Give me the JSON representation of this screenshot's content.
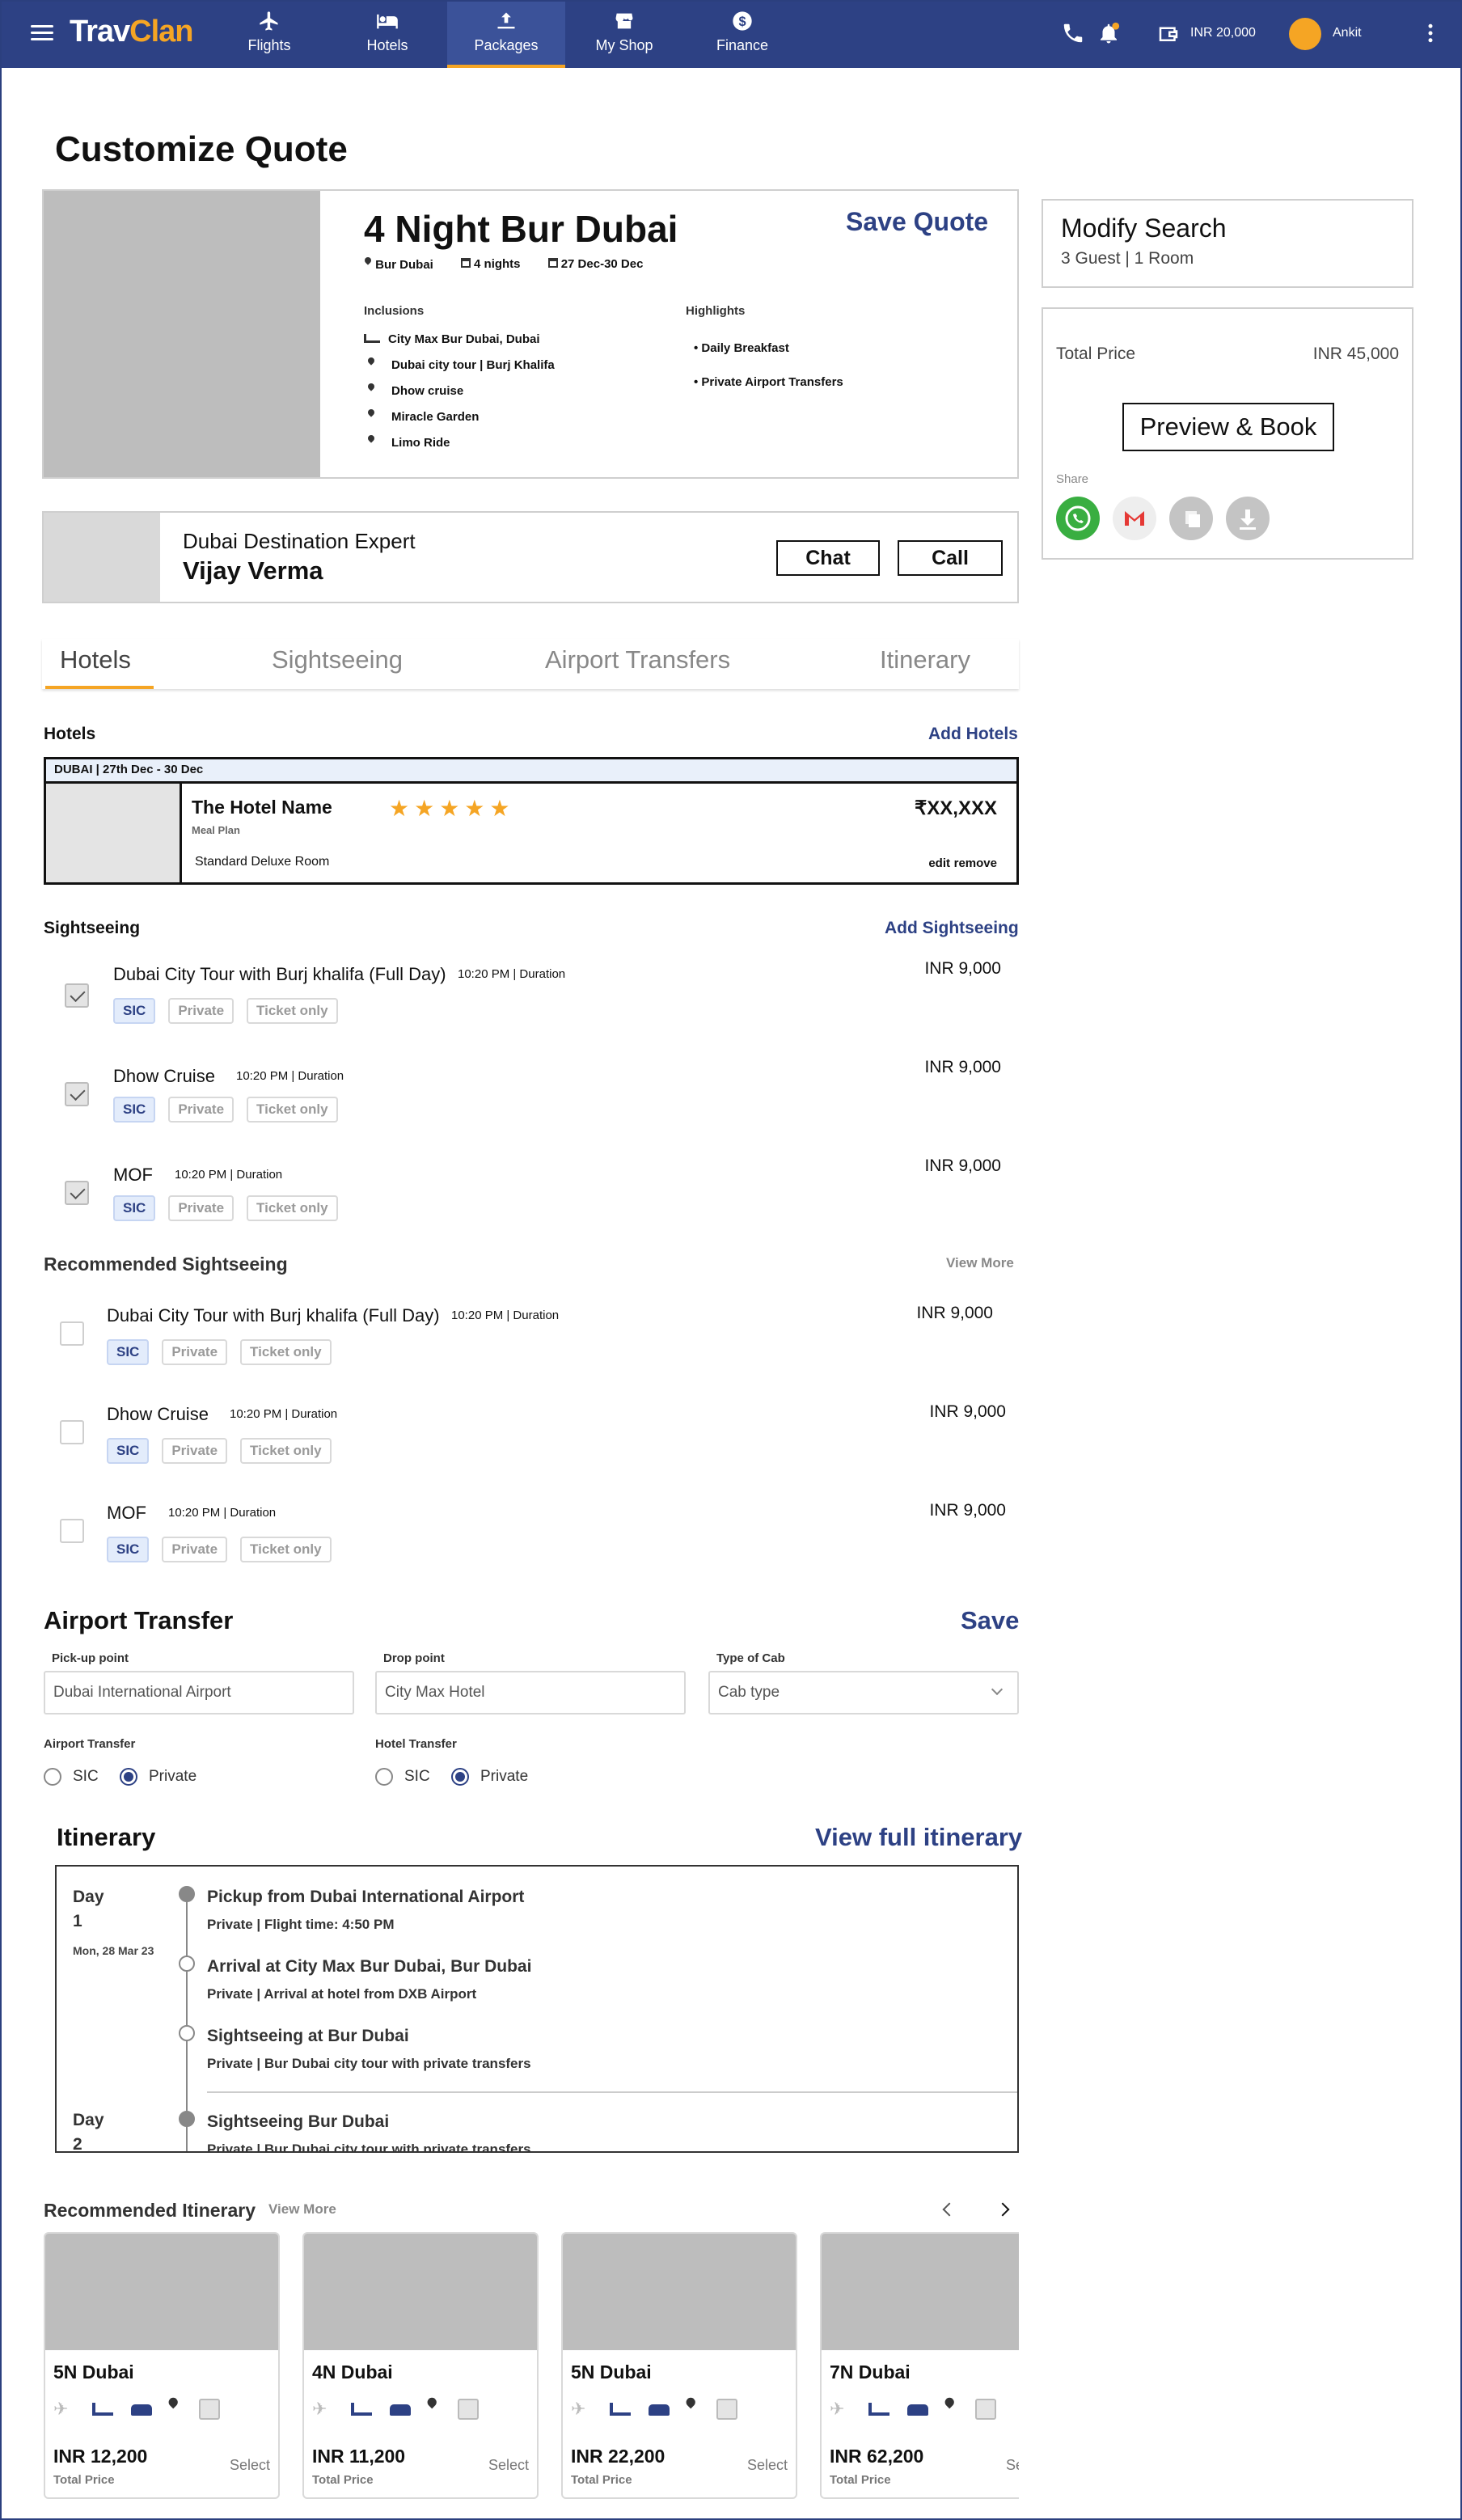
{
  "header": {
    "brand_a": "Trav",
    "brand_b": "Clan",
    "nav": [
      {
        "label": "Flights",
        "icon": "plane-icon"
      },
      {
        "label": "Hotels",
        "icon": "bed-icon"
      },
      {
        "label": "Packages",
        "icon": "package-icon",
        "active": true
      },
      {
        "label": "My Shop",
        "icon": "shop-icon"
      },
      {
        "label": "Finance",
        "icon": "dollar-icon"
      }
    ],
    "wallet": "INR 20,000",
    "user": "Ankit"
  },
  "page": {
    "title": "Customize Quote"
  },
  "package": {
    "name": "4 Night Bur Dubai",
    "save_quote": "Save Quote",
    "location": "Bur Dubai",
    "nights": "4 nights",
    "dates": "27 Dec-30 Dec",
    "inclusions_label": "Inclusions",
    "inclusions": [
      "City Max Bur Dubai, Dubai",
      "Dubai city tour | Burj Khalifa",
      "Dhow cruise",
      "Miracle Garden",
      "Limo Ride"
    ],
    "highlights_label": "Highlights",
    "highlights": [
      "Daily Breakfast",
      "Private Airport Transfers"
    ]
  },
  "expert": {
    "role": "Dubai Destination Expert",
    "name": "Vijay Verma",
    "chat": "Chat",
    "call": "Call"
  },
  "modify": {
    "title": "Modify Search",
    "sub": "3 Guest | 1 Room"
  },
  "price": {
    "label": "Total Price",
    "value": "INR 45,000",
    "cta": "Preview & Book",
    "share": "Share"
  },
  "tabs": [
    "Hotels",
    "Sightseeing",
    "Airport Transfers",
    "Itinerary"
  ],
  "hotels": {
    "title": "Hotels",
    "add_a": "Add",
    "add_b": "Hotels",
    "band": "DUBAI | 27th Dec - 30 Dec",
    "name": "The Hotel Name",
    "meal": "Meal Plan",
    "room": "Standard Deluxe Room",
    "price": "₹XX,XXX",
    "edit": "edit",
    "remove": "remove",
    "stars": 5
  },
  "sightseeing": {
    "title": "Sightseeing",
    "add_a": "Add",
    "add_b": "Sightseeing",
    "items": [
      {
        "name": "Dubai City Tour with Burj khalifa (Full Day)",
        "time": "10:20 PM | Duration",
        "price": "INR 9,000"
      },
      {
        "name": "Dhow Cruise",
        "time": "10:20 PM | Duration",
        "price": "INR 9,000"
      },
      {
        "name": "MOF",
        "time": "10:20 PM | Duration",
        "price": "INR 9,000"
      }
    ],
    "chips": [
      "SIC",
      "Private",
      "Ticket only"
    ]
  },
  "recommended": {
    "title": "Recommended Sightseeing",
    "more": "View More",
    "items": [
      {
        "name": "Dubai City Tour with Burj khalifa (Full Day)",
        "time": "10:20 PM | Duration",
        "price": "INR 9,000"
      },
      {
        "name": "Dhow Cruise",
        "time": "10:20 PM | Duration",
        "price": "INR 9,000"
      },
      {
        "name": "MOF",
        "time": "10:20 PM | Duration",
        "price": "INR 9,000"
      }
    ]
  },
  "transfer": {
    "title": "Airport Transfer",
    "save": "Save",
    "pickup_label": "Pick-up point",
    "pickup": "Dubai International Airport",
    "drop_label": "Drop point",
    "drop": "City Max Hotel",
    "cab_label": "Type of Cab",
    "cab": "Cab type",
    "airport_label": "Airport Transfer",
    "hotel_label": "Hotel Transfer",
    "opt_sic": "SIC",
    "opt_private": "Private"
  },
  "itinerary": {
    "title": "Itinerary",
    "view": "View full itinerary",
    "day1": "Day",
    "day1n": "1",
    "day1date": "Mon, 28 Mar 23",
    "day2": "Day",
    "day2n": "2",
    "events": [
      {
        "t": "Pickup from Dubai International Airport",
        "s": "Private | Flight time: 4:50 PM"
      },
      {
        "t": "Arrival at City Max Bur Dubai, Bur Dubai",
        "s": "Private | Arrival at hotel from DXB Airport"
      },
      {
        "t": "Sightseeing at Bur Dubai",
        "s": "Private | Bur Dubai city tour with private transfers"
      },
      {
        "t": "Sightseeing Bur Dubai",
        "s": "Private | Bur Dubai city tour with private transfers"
      }
    ]
  },
  "rec_itin": {
    "title": "Recommended Itinerary",
    "more": "View More",
    "cards": [
      {
        "name": "5N Dubai",
        "price": "INR 12,200"
      },
      {
        "name": "4N Dubai",
        "price": "INR 11,200"
      },
      {
        "name": "5N Dubai",
        "price": "INR 22,200"
      },
      {
        "name": "7N Dubai",
        "price": "INR 62,200"
      }
    ],
    "total": "Total Price",
    "select": "Select"
  },
  "colors": {
    "brand": "#2d4184",
    "accent": "#f5a524"
  }
}
